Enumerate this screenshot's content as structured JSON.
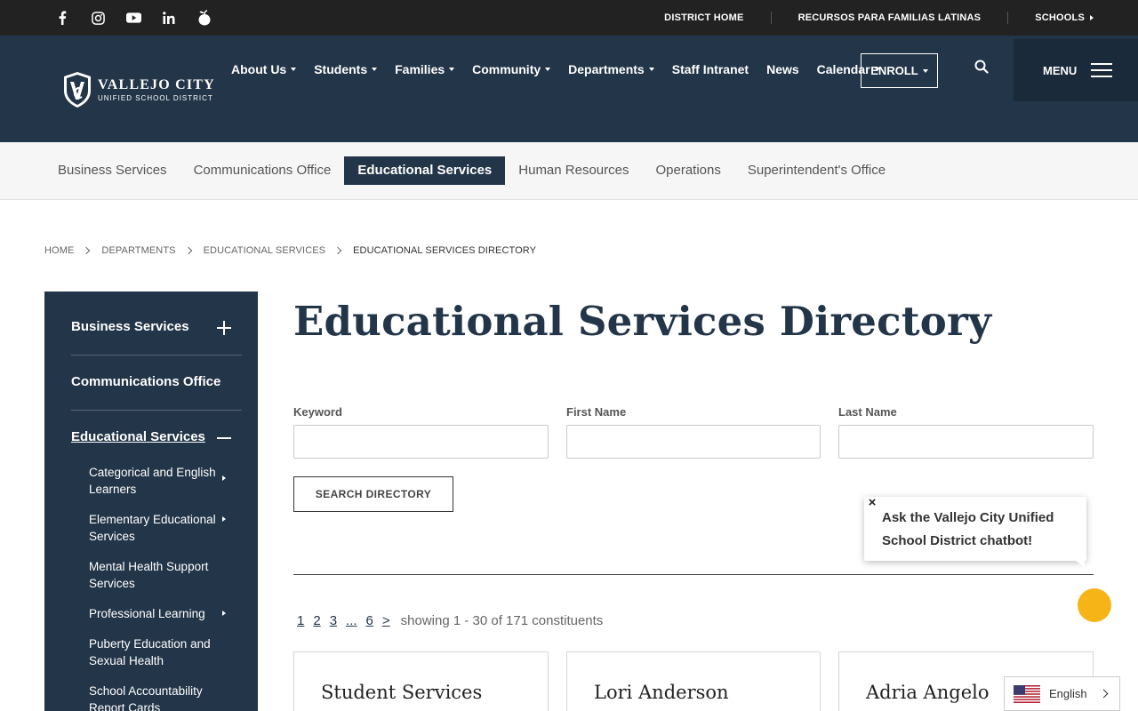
{
  "topbar": {
    "social": [
      "facebook-icon",
      "instagram-icon",
      "youtube-icon",
      "linkedin-icon",
      "peachjar-icon"
    ],
    "links": [
      {
        "label": "DISTRICT HOME"
      },
      {
        "label": "RECURSOS PARA FAMILIAS LATINAS"
      },
      {
        "label": "SCHOOLS"
      }
    ]
  },
  "header": {
    "logo_title": "VALLEJO CITY",
    "logo_sub": "UNIFIED SCHOOL DISTRICT",
    "nav": [
      {
        "label": "About Us",
        "dropdown": true
      },
      {
        "label": "Students",
        "dropdown": true
      },
      {
        "label": "Families",
        "dropdown": true
      },
      {
        "label": "Community",
        "dropdown": true
      },
      {
        "label": "Departments",
        "dropdown": true
      },
      {
        "label": "Staff Intranet",
        "dropdown": false
      },
      {
        "label": "News",
        "dropdown": false
      },
      {
        "label": "Calendar",
        "dropdown": true
      }
    ],
    "enroll_label": "ENROLL",
    "menu_label": "MENU"
  },
  "subnav": {
    "items": [
      {
        "label": "Business Services",
        "active": false
      },
      {
        "label": "Communications Office",
        "active": false
      },
      {
        "label": "Educational Services",
        "active": true
      },
      {
        "label": "Human Resources",
        "active": false
      },
      {
        "label": "Operations",
        "active": false
      },
      {
        "label": "Superintendent's Office",
        "active": false
      }
    ]
  },
  "breadcrumb": [
    "HOME",
    "DEPARTMENTS",
    "EDUCATIONAL SERVICES",
    "EDUCATIONAL SERVICES DIRECTORY"
  ],
  "sidebar": {
    "top_items": [
      {
        "label": "Business Services",
        "state": "collapsed"
      },
      {
        "label": "Communications Office",
        "state": "none"
      },
      {
        "label": "Educational Services",
        "state": "expanded"
      }
    ],
    "sub_items": [
      {
        "label": "Categorical and English Learners",
        "has_children": true
      },
      {
        "label": "Elementary Educational Services",
        "has_children": true
      },
      {
        "label": "Mental Health Support Services",
        "has_children": false
      },
      {
        "label": "Professional Learning",
        "has_children": true
      },
      {
        "label": "Puberty Education and Sexual Health",
        "has_children": false
      },
      {
        "label": "School Accountability Report Cards",
        "has_children": false
      }
    ]
  },
  "main": {
    "title": "Educational Services Directory",
    "fields": [
      {
        "label": "Keyword",
        "value": ""
      },
      {
        "label": "First Name",
        "value": ""
      },
      {
        "label": "Last Name",
        "value": ""
      }
    ],
    "search_button": "SEARCH DIRECTORY",
    "pagination": {
      "pages": [
        "1",
        "2",
        "3",
        "...",
        "6",
        ">"
      ],
      "info": "showing 1 - 30 of 171 constituents"
    },
    "cards": [
      {
        "name": "Student Services"
      },
      {
        "name": "Lori Anderson"
      },
      {
        "name": "Adria Angelo"
      }
    ]
  },
  "chatbot": {
    "text": "Ask the Vallejo City Unified School District chatbot!",
    "close": "×"
  },
  "language": {
    "label": "English",
    "flag": "us-flag-icon"
  },
  "colors": {
    "navy": "#233548",
    "topbar": "#222222",
    "accent_yellow": "#f6b417",
    "subnav_bg": "#f6f6f6"
  }
}
